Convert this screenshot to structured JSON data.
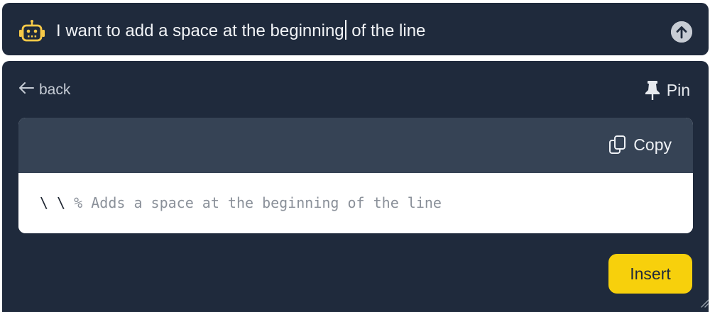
{
  "prompt": {
    "text_before_caret": "I want to add a space at the beginning",
    "text_after_caret": " of the line"
  },
  "panel": {
    "back_label": "back",
    "pin_label": "Pin"
  },
  "code": {
    "copy_label": "Copy",
    "command": "\\ \\ ",
    "comment": "% Adds a space at the beginning of the line"
  },
  "actions": {
    "insert_label": "Insert"
  },
  "colors": {
    "panel_bg": "#1f2a3c",
    "code_header_bg": "#364355",
    "accent_yellow": "#f7d00c"
  },
  "icons": {
    "assistant": "robot-icon",
    "send": "arrow-up-circle-icon",
    "back": "arrow-left-icon",
    "pin": "pushpin-icon",
    "copy": "copy-icon",
    "resize": "resize-handle-icon"
  }
}
